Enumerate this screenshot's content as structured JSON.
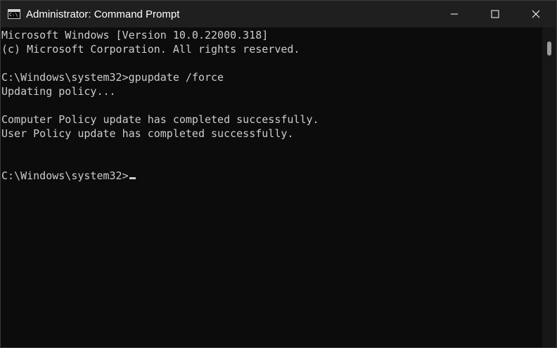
{
  "window": {
    "title": "Administrator: Command Prompt",
    "icon": "cmd-icon",
    "icon_glyph": "C:\\"
  },
  "controls": {
    "minimize": "minimize-icon",
    "maximize": "maximize-icon",
    "close": "close-icon"
  },
  "console": {
    "lines": [
      "Microsoft Windows [Version 10.0.22000.318]",
      "(c) Microsoft Corporation. All rights reserved.",
      "",
      "C:\\Windows\\system32>gpupdate /force",
      "Updating policy...",
      "",
      "Computer Policy update has completed successfully.",
      "User Policy update has completed successfully.",
      "",
      "",
      "C:\\Windows\\system32>"
    ]
  },
  "colors": {
    "background": "#0c0c0c",
    "titlebar": "#1f1f1f",
    "text": "#cccccc"
  }
}
